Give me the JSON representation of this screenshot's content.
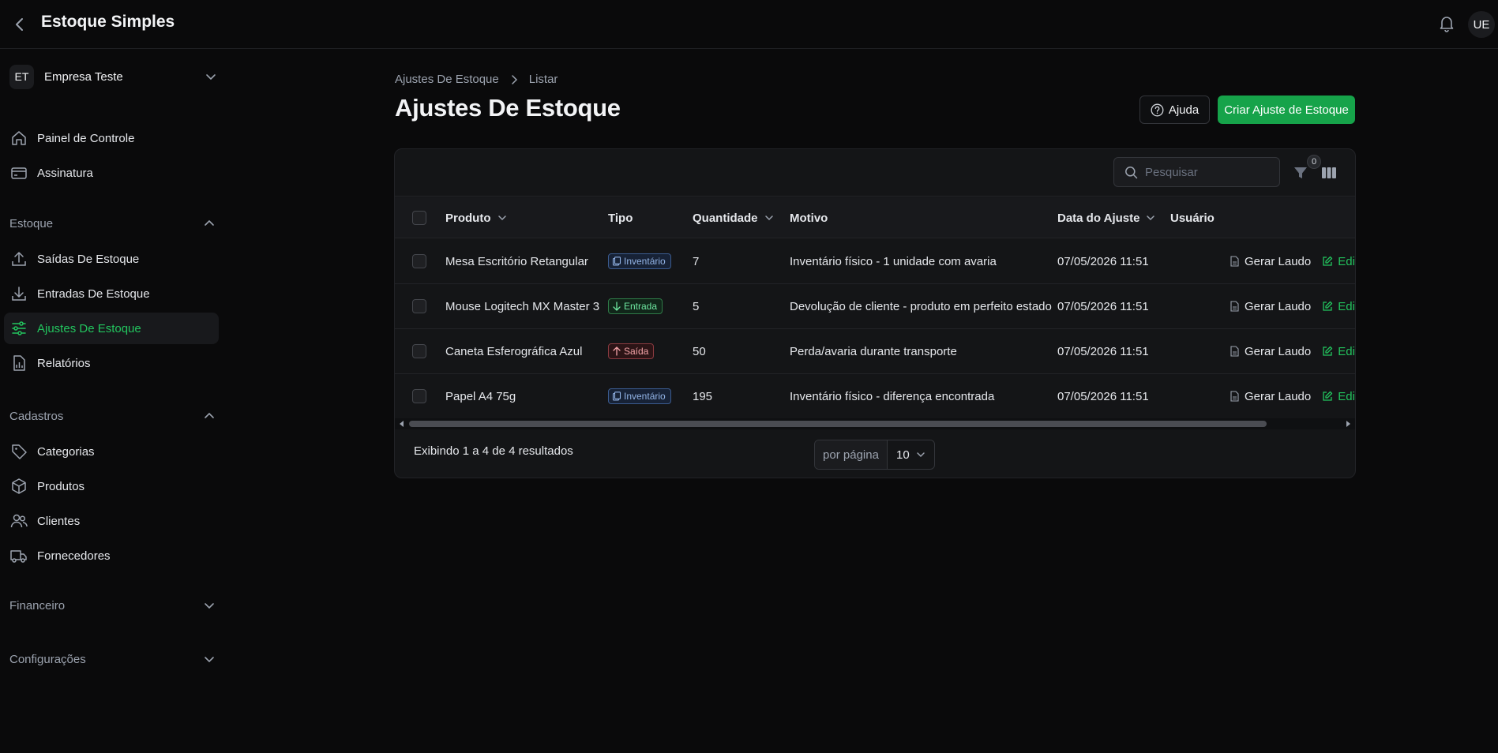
{
  "app": {
    "title": "Estoque Simples",
    "user_initials": "UE"
  },
  "company": {
    "initials": "ET",
    "name": "Empresa Teste"
  },
  "sidebar": {
    "top_items": [
      {
        "label": "Painel de Controle",
        "icon": "home-icon"
      },
      {
        "label": "Assinatura",
        "icon": "credit-card-icon"
      }
    ],
    "groups": {
      "estoque": {
        "label": "Estoque",
        "items": [
          {
            "label": "Saídas De Estoque",
            "icon": "upload-icon"
          },
          {
            "label": "Entradas De Estoque",
            "icon": "download-icon"
          },
          {
            "label": "Ajustes De Estoque",
            "icon": "sliders-icon",
            "active": true
          },
          {
            "label": "Relatórios",
            "icon": "report-icon"
          }
        ]
      },
      "cadastros": {
        "label": "Cadastros",
        "items": [
          {
            "label": "Categorias",
            "icon": "tag-icon"
          },
          {
            "label": "Produtos",
            "icon": "cube-icon"
          },
          {
            "label": "Clientes",
            "icon": "users-icon"
          },
          {
            "label": "Fornecedores",
            "icon": "truck-icon"
          }
        ]
      },
      "financeiro": {
        "label": "Financeiro"
      },
      "configuracoes": {
        "label": "Configurações"
      }
    }
  },
  "breadcrumb": {
    "parent": "Ajustes De Estoque",
    "current": "Listar"
  },
  "page": {
    "title": "Ajustes De Estoque",
    "help_label": "Ajuda",
    "create_label": "Criar Ajuste de Estoque"
  },
  "table": {
    "search_placeholder": "Pesquisar",
    "filter_count": "0",
    "columns": {
      "produto": "Produto",
      "tipo": "Tipo",
      "quantidade": "Quantidade",
      "motivo": "Motivo",
      "data": "Data do Ajuste",
      "usuario": "Usuário"
    },
    "actions": {
      "report": "Gerar Laudo",
      "edit": "Editar"
    },
    "rows": [
      {
        "produto": "Mesa Escritório Retangular",
        "tipo": "Inventário",
        "quantidade": "7",
        "motivo": "Inventário físico - 1 unidade com avaria",
        "data": "07/05/2026 11:51"
      },
      {
        "produto": "Mouse Logitech MX Master 3",
        "tipo": "Entrada",
        "quantidade": "5",
        "motivo": "Devolução de cliente - produto em perfeito estado",
        "data": "07/05/2026 11:51"
      },
      {
        "produto": "Caneta Esferográfica Azul",
        "tipo": "Saída",
        "quantidade": "50",
        "motivo": "Perda/avaria durante transporte",
        "data": "07/05/2026 11:51"
      },
      {
        "produto": "Papel A4 75g",
        "tipo": "Inventário",
        "quantidade": "195",
        "motivo": "Inventário físico - diferença encontrada",
        "data": "07/05/2026 11:51"
      }
    ],
    "summary": "Exibindo 1 a 4 de 4 resultados",
    "per_page_label": "por página",
    "per_page_value": "10"
  },
  "colors": {
    "accent": "#16a34a",
    "accent_text": "#22c55e",
    "background": "#0a0a0b",
    "card": "#141517"
  }
}
